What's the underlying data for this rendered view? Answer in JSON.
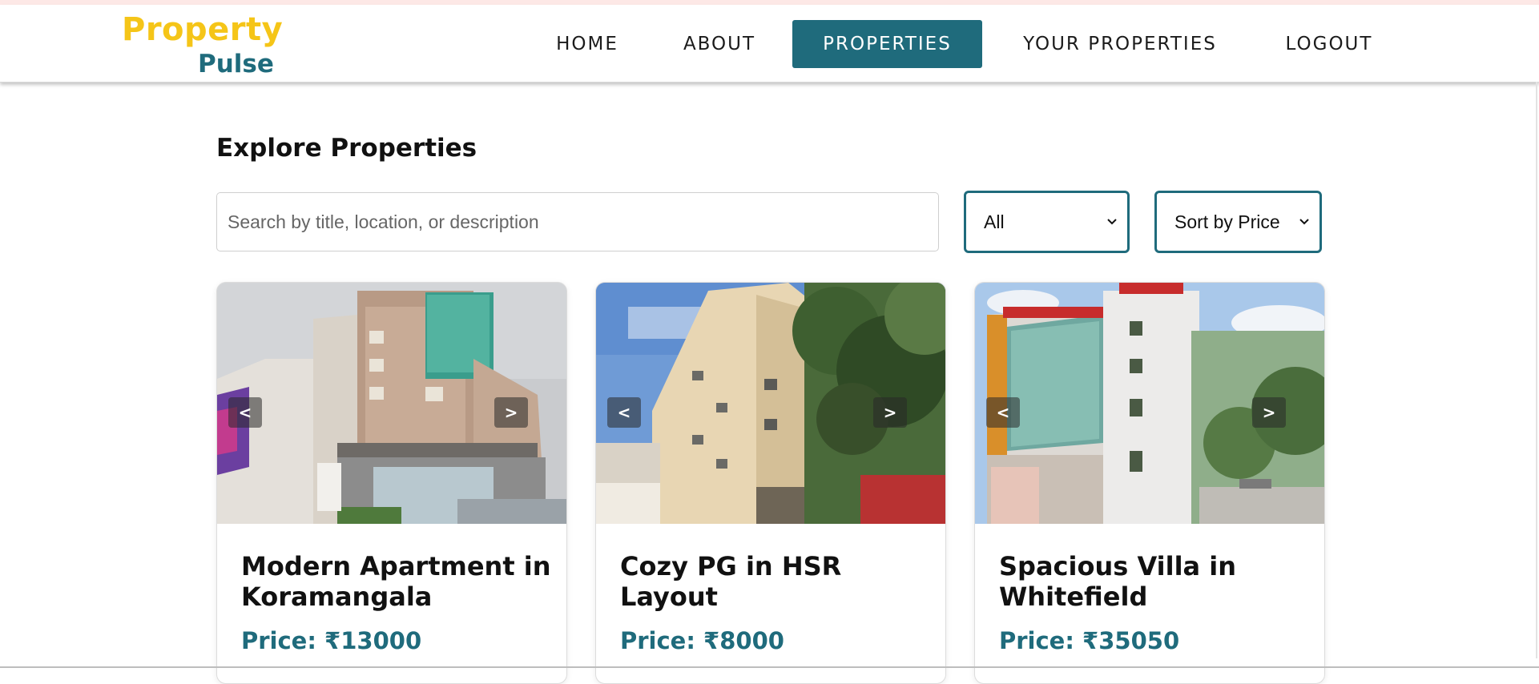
{
  "brand": {
    "name_top": "Property",
    "name_bottom": "Pulse"
  },
  "nav": {
    "items": [
      {
        "label": "HOME"
      },
      {
        "label": "ABOUT"
      },
      {
        "label": "PROPERTIES",
        "active": true
      },
      {
        "label": "YOUR PROPERTIES"
      },
      {
        "label": "LOGOUT"
      }
    ]
  },
  "page": {
    "title": "Explore Properties"
  },
  "search": {
    "placeholder": "Search by title, location, or description",
    "value": ""
  },
  "filters": {
    "type_selected": "All",
    "sort_selected": "Sort by Price"
  },
  "carousel": {
    "prev": "<",
    "next": ">"
  },
  "listings": [
    {
      "title": "Modern Apartment in Koramangala",
      "price": "Price: ₹13000"
    },
    {
      "title": "Cozy PG in HSR Layout",
      "price": "Price: ₹8000"
    },
    {
      "title": "Spacious Villa in Whitefield",
      "price": "Price: ₹35050"
    }
  ],
  "colors": {
    "brand_yellow": "#f5c518",
    "brand_teal": "#1f6b7c",
    "nav_text": "#1b1b1b"
  }
}
